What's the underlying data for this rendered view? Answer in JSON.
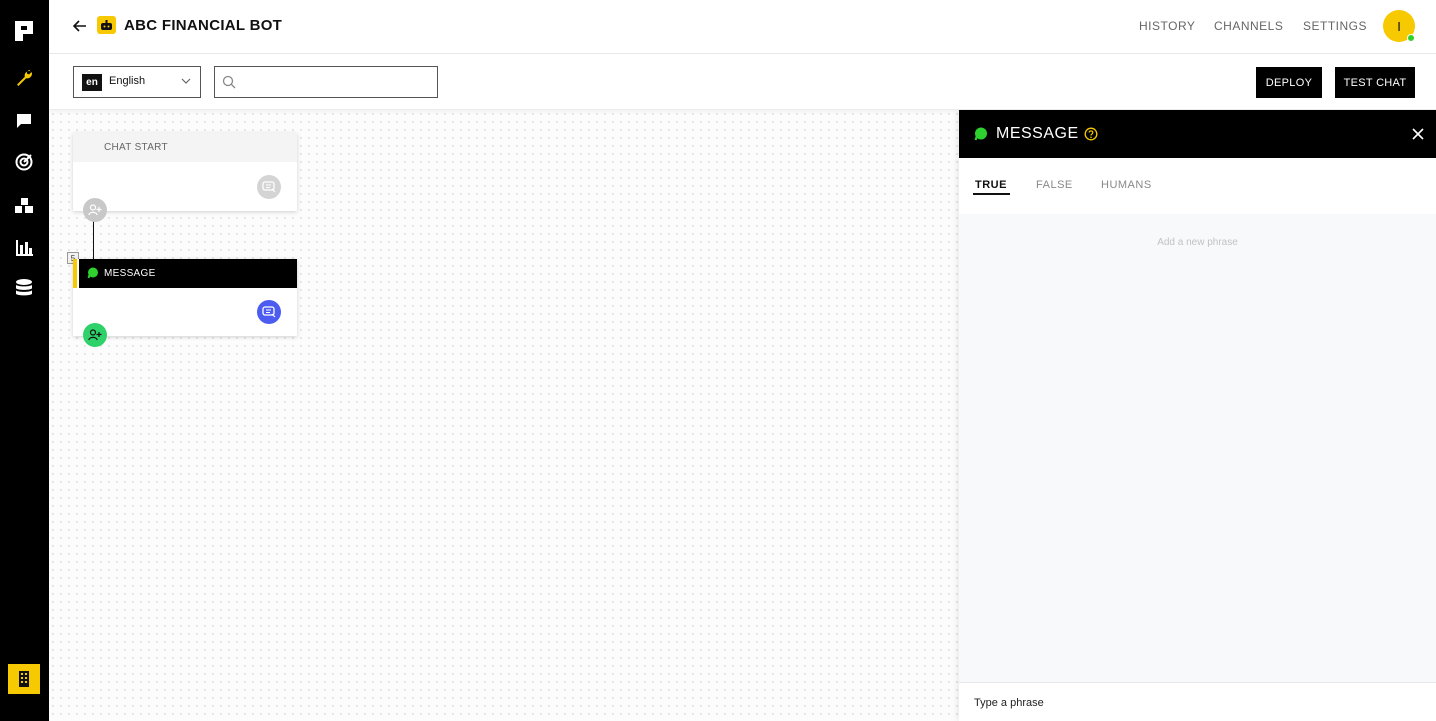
{
  "header": {
    "bot_title": "ABC FINANCIAL BOT",
    "nav": [
      "HISTORY",
      "CHANNELS",
      "SETTINGS"
    ],
    "avatar_initial": "I"
  },
  "toolbar": {
    "lang_code": "en",
    "lang_label": "English",
    "search_value": "",
    "deploy_label": "DEPLOY",
    "test_chat_label": "TEST CHAT"
  },
  "canvas": {
    "chat_start_label": "CHAT START",
    "message_node_label": "MESSAGE",
    "message_node_badge": "5"
  },
  "panel": {
    "title": "MESSAGE",
    "tabs": [
      "TRUE",
      "FALSE",
      "HUMANS"
    ],
    "active_tab": "TRUE",
    "phrase_hint": "Add a new phrase",
    "phrase_placeholder": "Type a phrase"
  },
  "colors": {
    "accent_yellow": "#f7c900",
    "whatsapp_green": "#2ed12e",
    "action_blue": "#4d5cf0",
    "sidebar_bg": "#000000"
  },
  "icons": {
    "sidebar": [
      "app-logo-icon",
      "wrench-icon",
      "chat-icon",
      "target-icon",
      "blocks-icon",
      "bar-chart-icon",
      "database-icon",
      "building-icon"
    ]
  }
}
